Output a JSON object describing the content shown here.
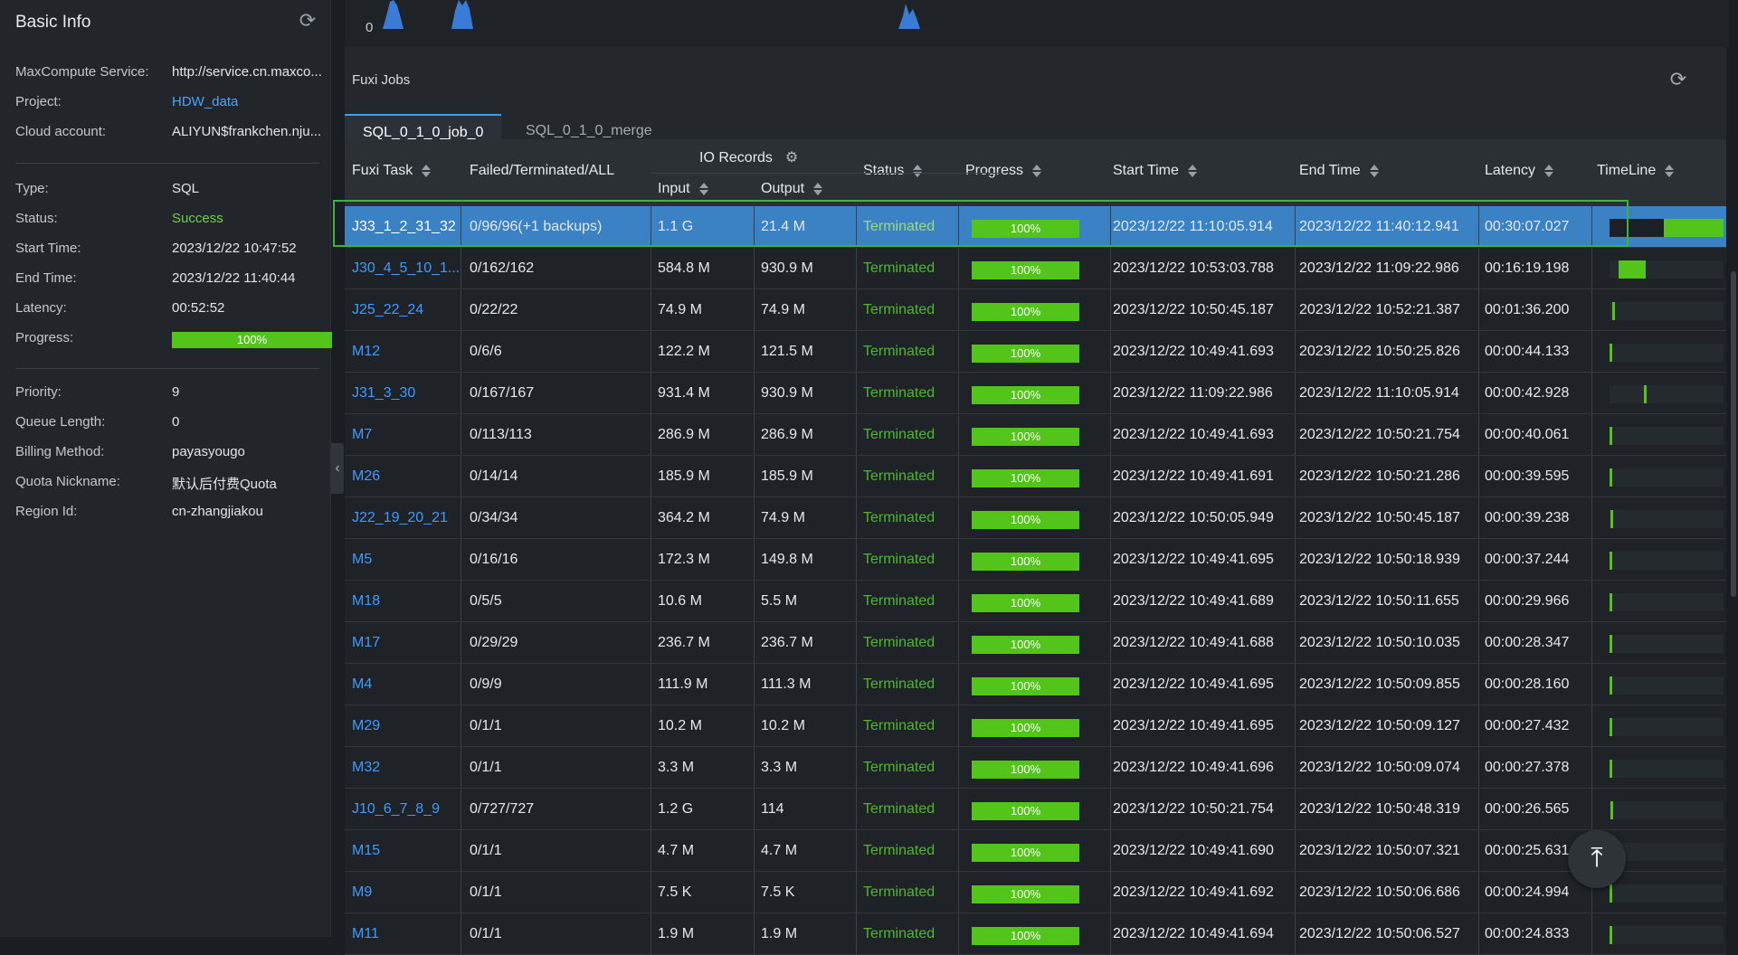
{
  "basic_info": {
    "title": "Basic Info",
    "refresh_icon": "refresh-icon",
    "group1": [
      {
        "key": "MaxCompute Service:",
        "value": "http://service.cn.maxco...",
        "style": ""
      },
      {
        "key": "Project:",
        "value": "HDW_data",
        "style": "link"
      },
      {
        "key": "Cloud account:",
        "value": "ALIYUN$frankchen.nju...",
        "style": ""
      }
    ],
    "group2": [
      {
        "key": "Type:",
        "value": "SQL",
        "style": ""
      },
      {
        "key": "Status:",
        "value": "Success",
        "style": "success"
      },
      {
        "key": "Start Time:",
        "value": "2023/12/22 10:47:52",
        "style": ""
      },
      {
        "key": "End Time:",
        "value": "2023/12/22 11:40:44",
        "style": ""
      },
      {
        "key": "Latency:",
        "value": "00:52:52",
        "style": ""
      }
    ],
    "progress_label": "Progress:",
    "progress_value": "100%",
    "progress_fraction": 1.0,
    "group3": [
      {
        "key": "Priority:",
        "value": "9",
        "style": ""
      },
      {
        "key": "Queue Length:",
        "value": "0",
        "style": ""
      },
      {
        "key": "Billing Method:",
        "value": "payasyougo",
        "style": ""
      },
      {
        "key": "Quota Nickname:",
        "value": "默认后付费Quota",
        "style": ""
      },
      {
        "key": "Region Id:",
        "value": "cn-zhangjiakou",
        "style": ""
      }
    ]
  },
  "top_chart": {
    "zero_label": "0"
  },
  "fuxi_jobs": {
    "title": "Fuxi Jobs",
    "tabs": [
      {
        "label": "SQL_0_1_0_job_0",
        "active": true
      },
      {
        "label": "SQL_0_1_0_merge",
        "active": false
      }
    ],
    "columns": {
      "task": "Fuxi Task",
      "ftall": "Failed/Terminated/ALL",
      "io": "IO Records",
      "input": "Input",
      "output": "Output",
      "status": "Status",
      "progress": "Progress",
      "start": "Start Time",
      "end": "End Time",
      "latency": "Latency",
      "timeline": "TimeLine"
    },
    "rows": [
      {
        "task": "J33_1_2_31_32",
        "ftall": "0/96/96(+1 backups)",
        "input": "1.1 G",
        "output": "21.4 M",
        "status": "Terminated",
        "progress": "100%",
        "start": "2023/12/22 11:10:05.914",
        "end": "2023/12/22 11:40:12.941",
        "latency": "00:30:07.027",
        "selected": true
      },
      {
        "task": "J30_4_5_10_1...",
        "ftall": "0/162/162",
        "input": "584.8 M",
        "output": "930.9 M",
        "status": "Terminated",
        "progress": "100%",
        "start": "2023/12/22 10:53:03.788",
        "end": "2023/12/22 11:09:22.986",
        "latency": "00:16:19.198"
      },
      {
        "task": "J25_22_24",
        "ftall": "0/22/22",
        "input": "74.9 M",
        "output": "74.9 M",
        "status": "Terminated",
        "progress": "100%",
        "start": "2023/12/22 10:50:45.187",
        "end": "2023/12/22 10:52:21.387",
        "latency": "00:01:36.200"
      },
      {
        "task": "M12",
        "ftall": "0/6/6",
        "input": "122.2 M",
        "output": "121.5 M",
        "status": "Terminated",
        "progress": "100%",
        "start": "2023/12/22 10:49:41.693",
        "end": "2023/12/22 10:50:25.826",
        "latency": "00:00:44.133"
      },
      {
        "task": "J31_3_30",
        "ftall": "0/167/167",
        "input": "931.4 M",
        "output": "930.9 M",
        "status": "Terminated",
        "progress": "100%",
        "start": "2023/12/22 11:09:22.986",
        "end": "2023/12/22 11:10:05.914",
        "latency": "00:00:42.928"
      },
      {
        "task": "M7",
        "ftall": "0/113/113",
        "input": "286.9 M",
        "output": "286.9 M",
        "status": "Terminated",
        "progress": "100%",
        "start": "2023/12/22 10:49:41.693",
        "end": "2023/12/22 10:50:21.754",
        "latency": "00:00:40.061"
      },
      {
        "task": "M26",
        "ftall": "0/14/14",
        "input": "185.9 M",
        "output": "185.9 M",
        "status": "Terminated",
        "progress": "100%",
        "start": "2023/12/22 10:49:41.691",
        "end": "2023/12/22 10:50:21.286",
        "latency": "00:00:39.595"
      },
      {
        "task": "J22_19_20_21",
        "ftall": "0/34/34",
        "input": "364.2 M",
        "output": "74.9 M",
        "status": "Terminated",
        "progress": "100%",
        "start": "2023/12/22 10:50:05.949",
        "end": "2023/12/22 10:50:45.187",
        "latency": "00:00:39.238"
      },
      {
        "task": "M5",
        "ftall": "0/16/16",
        "input": "172.3 M",
        "output": "149.8 M",
        "status": "Terminated",
        "progress": "100%",
        "start": "2023/12/22 10:49:41.695",
        "end": "2023/12/22 10:50:18.939",
        "latency": "00:00:37.244"
      },
      {
        "task": "M18",
        "ftall": "0/5/5",
        "input": "10.6 M",
        "output": "5.5 M",
        "status": "Terminated",
        "progress": "100%",
        "start": "2023/12/22 10:49:41.689",
        "end": "2023/12/22 10:50:11.655",
        "latency": "00:00:29.966"
      },
      {
        "task": "M17",
        "ftall": "0/29/29",
        "input": "236.7 M",
        "output": "236.7 M",
        "status": "Terminated",
        "progress": "100%",
        "start": "2023/12/22 10:49:41.688",
        "end": "2023/12/22 10:50:10.035",
        "latency": "00:00:28.347"
      },
      {
        "task": "M4",
        "ftall": "0/9/9",
        "input": "111.9 M",
        "output": "111.3 M",
        "status": "Terminated",
        "progress": "100%",
        "start": "2023/12/22 10:49:41.695",
        "end": "2023/12/22 10:50:09.855",
        "latency": "00:00:28.160"
      },
      {
        "task": "M29",
        "ftall": "0/1/1",
        "input": "10.2 M",
        "output": "10.2 M",
        "status": "Terminated",
        "progress": "100%",
        "start": "2023/12/22 10:49:41.695",
        "end": "2023/12/22 10:50:09.127",
        "latency": "00:00:27.432"
      },
      {
        "task": "M32",
        "ftall": "0/1/1",
        "input": "3.3 M",
        "output": "3.3 M",
        "status": "Terminated",
        "progress": "100%",
        "start": "2023/12/22 10:49:41.696",
        "end": "2023/12/22 10:50:09.074",
        "latency": "00:00:27.378"
      },
      {
        "task": "J10_6_7_8_9",
        "ftall": "0/727/727",
        "input": "1.2 G",
        "output": "114",
        "status": "Terminated",
        "progress": "100%",
        "start": "2023/12/22 10:50:21.754",
        "end": "2023/12/22 10:50:48.319",
        "latency": "00:00:26.565"
      },
      {
        "task": "M15",
        "ftall": "0/1/1",
        "input": "4.7 M",
        "output": "4.7 M",
        "status": "Terminated",
        "progress": "100%",
        "start": "2023/12/22 10:49:41.690",
        "end": "2023/12/22 10:50:07.321",
        "latency": "00:00:25.631"
      },
      {
        "task": "M9",
        "ftall": "0/1/1",
        "input": "7.5 K",
        "output": "7.5 K",
        "status": "Terminated",
        "progress": "100%",
        "start": "2023/12/22 10:49:41.692",
        "end": "2023/12/22 10:50:06.686",
        "latency": "00:00:24.994"
      },
      {
        "task": "M11",
        "ftall": "0/1/1",
        "input": "1.9 M",
        "output": "1.9 M",
        "status": "Terminated",
        "progress": "100%",
        "start": "2023/12/22 10:49:41.694",
        "end": "2023/12/22 10:50:06.527",
        "latency": "00:00:24.833"
      }
    ]
  },
  "colors": {
    "accent": "#3f9cf5",
    "success": "#52c41a",
    "link": "#3d9bff",
    "selected_row": "#3a82c4"
  }
}
